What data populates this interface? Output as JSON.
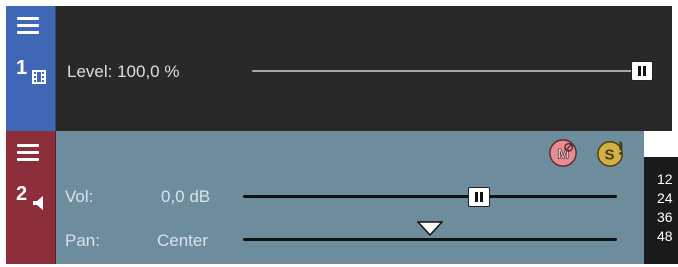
{
  "track1": {
    "number": "1",
    "type_icon": "video-film-icon",
    "level_label": "Level: 100,0 %",
    "level_fraction": 1.0,
    "header_color": "#3f67b6"
  },
  "track2": {
    "number": "2",
    "type_icon": "audio-speaker-icon",
    "vol_label": "Vol:",
    "vol_value": "0,0 dB",
    "vol_fraction": 0.63,
    "pan_label": "Pan:",
    "pan_value": "Center",
    "pan_fraction": 0.5,
    "mute_icon": "mute-icon",
    "solo_icon": "solo-icon",
    "header_color": "#8c2f3a"
  },
  "meter": {
    "scale": [
      "12",
      "24",
      "36",
      "48"
    ]
  }
}
